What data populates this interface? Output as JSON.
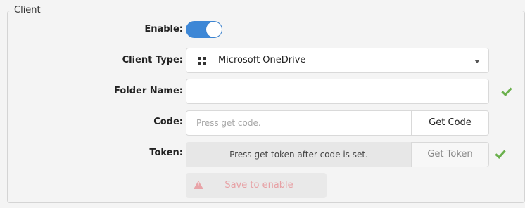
{
  "section": {
    "legend": "Client"
  },
  "fields": {
    "enable": {
      "label": "Enable:",
      "on": true
    },
    "client_type": {
      "label": "Client Type:",
      "value": "Microsoft OneDrive",
      "icon": "windows-icon"
    },
    "folder_name": {
      "label": "Folder Name:",
      "value": "",
      "valid": true
    },
    "code": {
      "label": "Code:",
      "placeholder": "Press get code.",
      "button": "Get Code"
    },
    "token": {
      "label": "Token:",
      "message": "Press get token after code is set.",
      "button": "Get Token",
      "valid": true
    }
  },
  "save": {
    "label": "Save to enable",
    "icon": "warning-icon"
  },
  "colors": {
    "toggle": "#3d87d6",
    "check": "#6ab04c",
    "warning": "#e8a4a8"
  }
}
